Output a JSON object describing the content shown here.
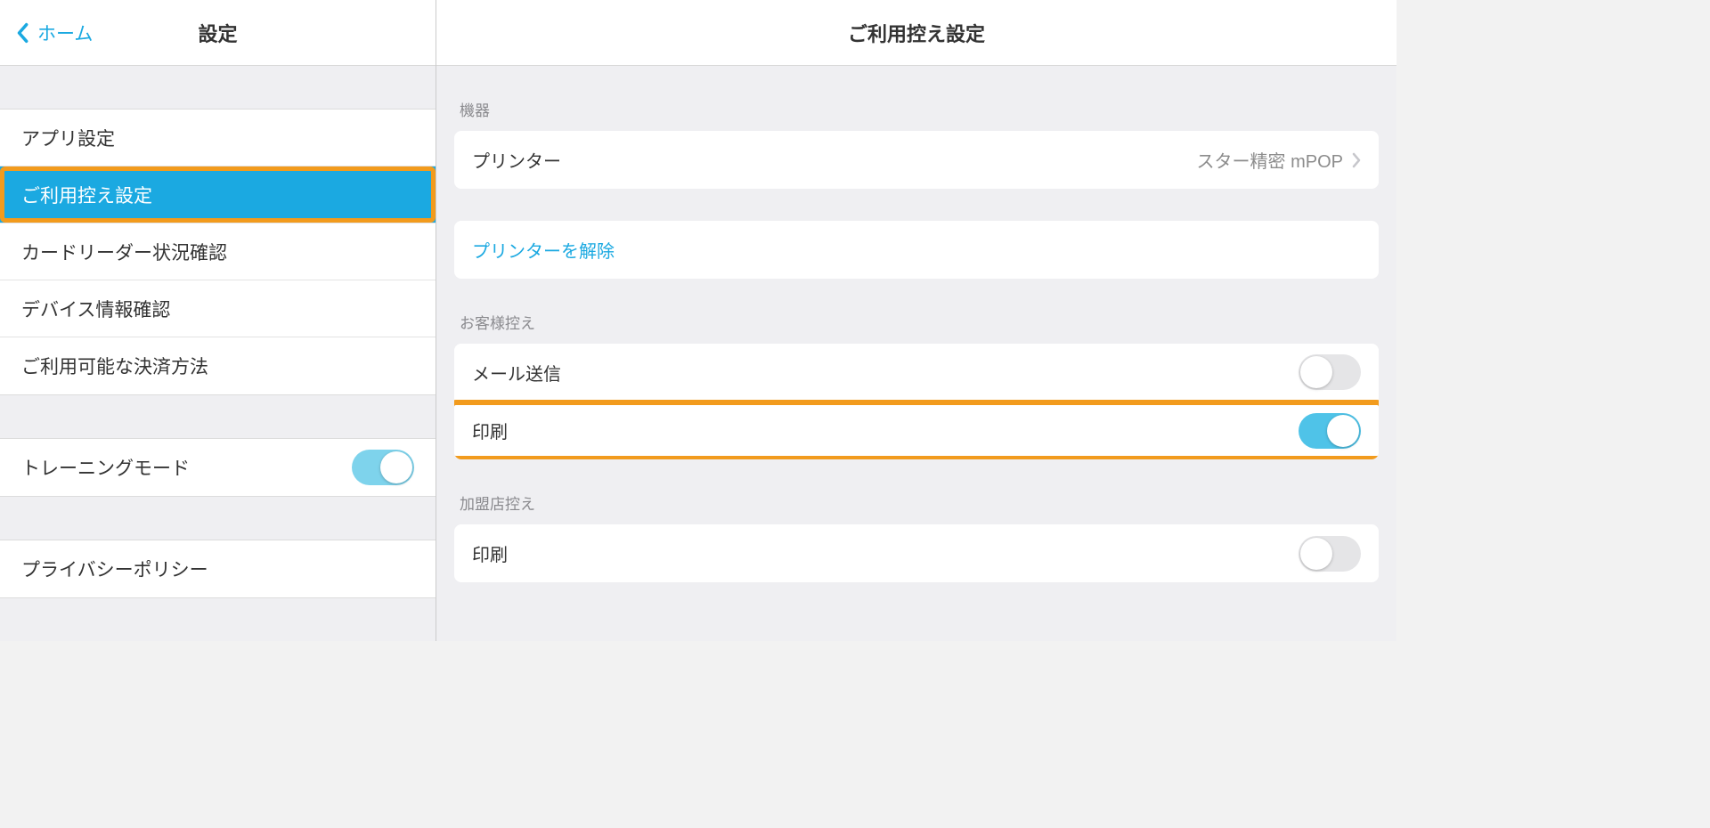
{
  "sidebar": {
    "back_label": "ホーム",
    "title": "設定",
    "group1": [
      {
        "label": "アプリ設定",
        "selected": false
      },
      {
        "label": "ご利用控え設定",
        "selected": true,
        "highlight": true
      },
      {
        "label": "カードリーダー状況確認",
        "selected": false
      },
      {
        "label": "デバイス情報確認",
        "selected": false
      },
      {
        "label": "ご利用可能な決済方法",
        "selected": false
      }
    ],
    "training_mode": {
      "label": "トレーニングモード",
      "on": true
    },
    "privacy": {
      "label": "プライバシーポリシー"
    }
  },
  "main": {
    "title": "ご利用控え設定",
    "device_section": {
      "label": "機器",
      "printer_label": "プリンター",
      "printer_value": "スター精密 mPOP",
      "unlink_label": "プリンターを解除"
    },
    "customer_section": {
      "label": "お客様控え",
      "mail": {
        "label": "メール送信",
        "on": false
      },
      "print": {
        "label": "印刷",
        "on": true,
        "highlight": true
      }
    },
    "merchant_section": {
      "label": "加盟店控え",
      "print": {
        "label": "印刷",
        "on": false
      }
    }
  },
  "colors": {
    "accent": "#1ba9e1",
    "highlight": "#f29b1d"
  }
}
